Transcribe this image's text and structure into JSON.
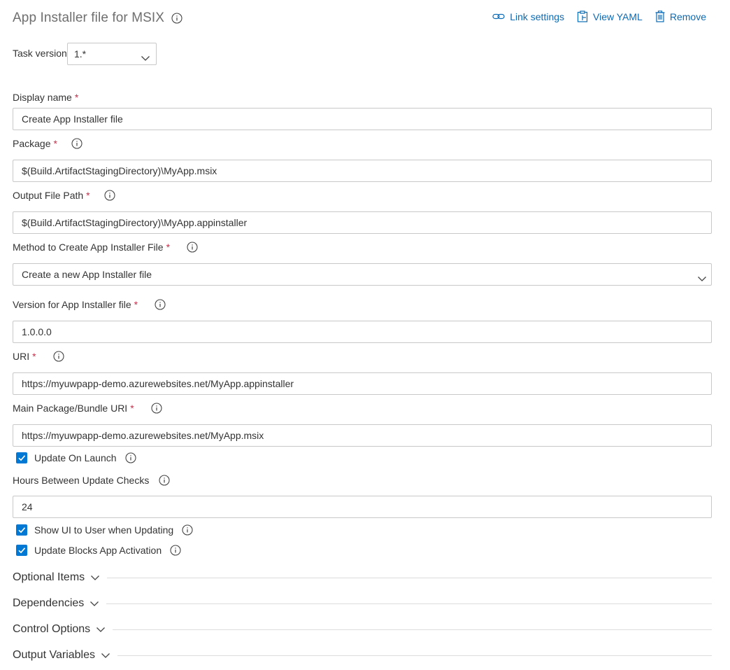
{
  "header": {
    "title": "App Installer file for MSIX",
    "actions": {
      "link_settings": "Link settings",
      "view_yaml": "View YAML",
      "remove": "Remove"
    }
  },
  "task_version": {
    "label": "Task version",
    "value": "1.*"
  },
  "fields": {
    "display_name": {
      "label": "Display name",
      "required": "*",
      "value": "Create App Installer file"
    },
    "package": {
      "label": "Package",
      "required": "*",
      "value": "$(Build.ArtifactStagingDirectory)\\MyApp.msix"
    },
    "output_file_path": {
      "label": "Output File Path",
      "required": "*",
      "value": "$(Build.ArtifactStagingDirectory)\\MyApp.appinstaller"
    },
    "method": {
      "label": "Method to Create App Installer File",
      "required": "*",
      "value": "Create a new App Installer file"
    },
    "version": {
      "label": "Version for App Installer file",
      "required": "*",
      "value": "1.0.0.0"
    },
    "uri": {
      "label": "URI",
      "required": "*",
      "value": "https://myuwpapp-demo.azurewebsites.net/MyApp.appinstaller"
    },
    "main_package_uri": {
      "label": "Main Package/Bundle URI",
      "required": "*",
      "value": "https://myuwpapp-demo.azurewebsites.net/MyApp.msix"
    },
    "hours_between_checks": {
      "label": "Hours Between Update Checks",
      "value": "24"
    }
  },
  "checkboxes": {
    "update_on_launch": {
      "label": "Update On Launch",
      "checked": true
    },
    "show_ui": {
      "label": "Show UI to User when Updating",
      "checked": true
    },
    "update_blocks": {
      "label": "Update Blocks App Activation",
      "checked": true
    }
  },
  "sections": {
    "optional_items": "Optional Items",
    "dependencies": "Dependencies",
    "control_options": "Control Options",
    "output_variables": "Output Variables"
  },
  "colors": {
    "accent": "#0078d4",
    "link": "#0b6ab5",
    "required": "#c4314b",
    "border": "#c8c8c8"
  },
  "icons": [
    "info-icon",
    "link-icon",
    "clipboard-icon",
    "trash-icon",
    "chevron-down-icon",
    "checkmark-icon"
  ]
}
